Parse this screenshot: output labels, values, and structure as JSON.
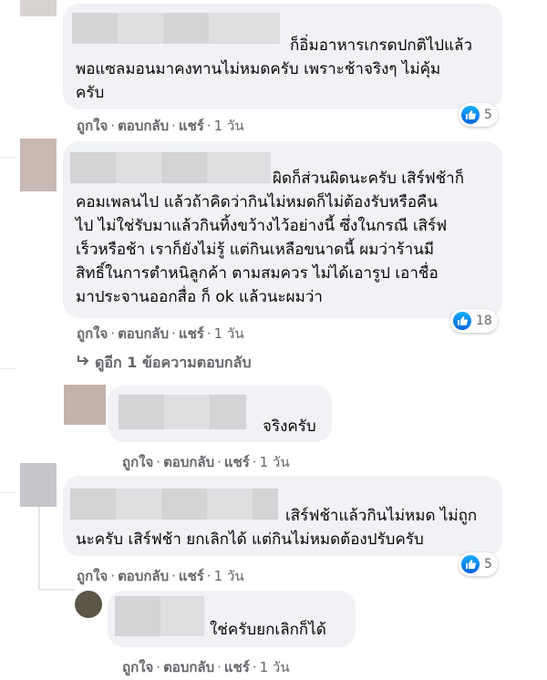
{
  "comments": [
    {
      "text": "ก็อิ่มอาหารเกรดปกติไปแล้ว\nพอแซลมอนมาคงทานไม่หมดครับ เพราะช้าจริงๆ ไม่คุ้ม\nครับ",
      "like": "ถูกใจ",
      "reply": "ตอบกลับ",
      "share": "แชร์",
      "time": "1 วัน",
      "reactions": "5"
    },
    {
      "text": "ผิดก็ส่วนผิดนะครับ เสิร์ฟช้าก็\nคอมเพลนไป แล้วถ้าคิดว่ากินไม่หมดก็ไม่ต้องรับหรือคืน\nไป ไม่ใช่รับมาแล้วกินทิ้งขว้างไว้อย่างนี้ ซึ่งในกรณี เสิร์ฟ\nเร็วหรือช้า เราก็ยังไม่รู้ แต่กินเหลือขนาดนี้ ผมว่าร้านมี\nสิทธิ์ในการตำหนิลูกค้า ตามสมควร ไม่ได้เอารูป เอาชื่อ\nมาประจานออกสื่อ ก็ ok แล้วนะผมว่า",
      "like": "ถูกใจ",
      "reply": "ตอบกลับ",
      "share": "แชร์",
      "time": "1 วัน",
      "reactions": "18",
      "more_replies": "ดูอีก 1 ข้อความตอบกลับ"
    },
    {
      "text": "จริงครับ",
      "like": "ถูกใจ",
      "reply": "ตอบกลับ",
      "share": "แชร์",
      "time": "1 วัน"
    },
    {
      "text": "เสิร์ฟช้าแล้วกินไม่หมด ไม่ถูก\nนะครับ เสิร์ฟช้า ยกเลิกได้ แต่กินไม่หมดต้องปรับครับ",
      "like": "ถูกใจ",
      "reply": "ตอบกลับ",
      "share": "แชร์",
      "time": "1 วัน",
      "reactions": "5"
    },
    {
      "text": "ใช่ครับยกเลิกก็ได้",
      "like": "ถูกใจ",
      "reply": "ตอบกลับ",
      "share": "แชร์",
      "time": "1 วัน"
    }
  ],
  "colors": {
    "bubble": "#f0f2f5",
    "action_text": "#65676b",
    "like_blue": "#1877f2"
  },
  "icons": [
    "like-icon",
    "reply-arrow-icon"
  ]
}
